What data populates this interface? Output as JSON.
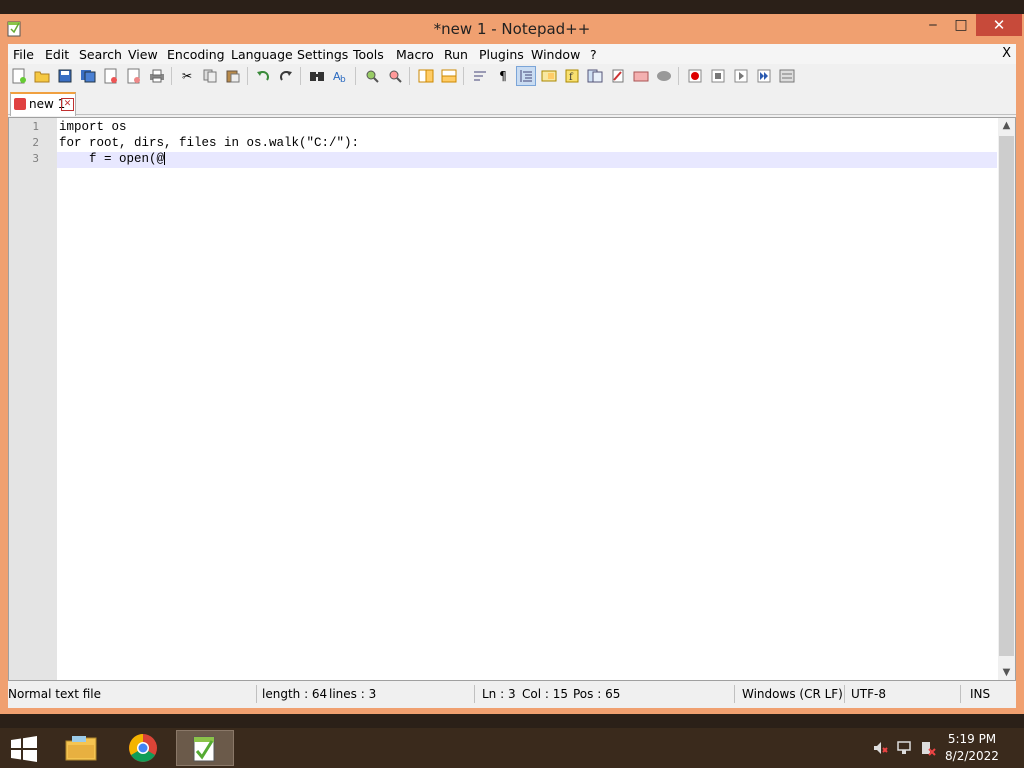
{
  "window": {
    "title": "*new 1 - Notepad++",
    "controls": {
      "minimize": "‒",
      "maximize": "□",
      "close": "✕"
    }
  },
  "menu": {
    "items": [
      "File",
      "Edit",
      "Search",
      "View",
      "Encoding",
      "Language",
      "Settings",
      "Tools",
      "Macro",
      "Run",
      "Plugins",
      "Window",
      "?"
    ],
    "doc_close": "X"
  },
  "toolbar": {
    "icons": [
      "new-file-icon",
      "open-file-icon",
      "save-icon",
      "save-all-icon",
      "close-icon",
      "close-all-icon",
      "print-icon",
      "cut-icon",
      "copy-icon",
      "paste-icon",
      "undo-icon",
      "redo-icon",
      "find-icon",
      "replace-icon",
      "zoom-in-icon",
      "zoom-out-icon",
      "sync-vertical-icon",
      "sync-horizontal-icon",
      "word-wrap-icon",
      "show-all-chars-icon",
      "indent-guide-icon",
      "document-map-icon",
      "function-list-icon",
      "folder-as-workspace-icon",
      "monitoring-icon",
      "clipboard-history-icon",
      "char-panel-icon",
      "record-macro-icon",
      "stop-record-icon",
      "play-macro-icon",
      "run-macro-multiple-icon",
      "save-macro-icon"
    ],
    "active": "indent-guide-icon"
  },
  "tabs": [
    {
      "label": "new 1",
      "close": "✕"
    }
  ],
  "editor": {
    "line_numbers": [
      "1",
      "2",
      "3"
    ],
    "lines": [
      "import os",
      "for root, dirs, files in os.walk(\"C:/\"):",
      "    f = open(@"
    ],
    "current_line": 3
  },
  "statusbar": {
    "file_type": "Normal text file",
    "length": "length : 64",
    "lines": "lines : 3",
    "ln": "Ln : 3",
    "col": "Col : 15",
    "pos": "Pos : 65",
    "eol": "Windows (CR LF)",
    "encoding": "UTF-8",
    "mode": "INS"
  },
  "taskbar": {
    "apps": [
      "file-explorer-icon",
      "chrome-icon",
      "notepad-plus-plus-icon"
    ],
    "tray_icons": [
      "volume-muted-icon",
      "network-icon",
      "action-center-icon"
    ],
    "time": "5:19 PM",
    "date": "8/2/2022"
  },
  "colors": {
    "titlebar": "#f0a070",
    "close_button": "#c74a3a",
    "taskbar": "#3a2a1c",
    "current_line": "#e8e8ff"
  }
}
